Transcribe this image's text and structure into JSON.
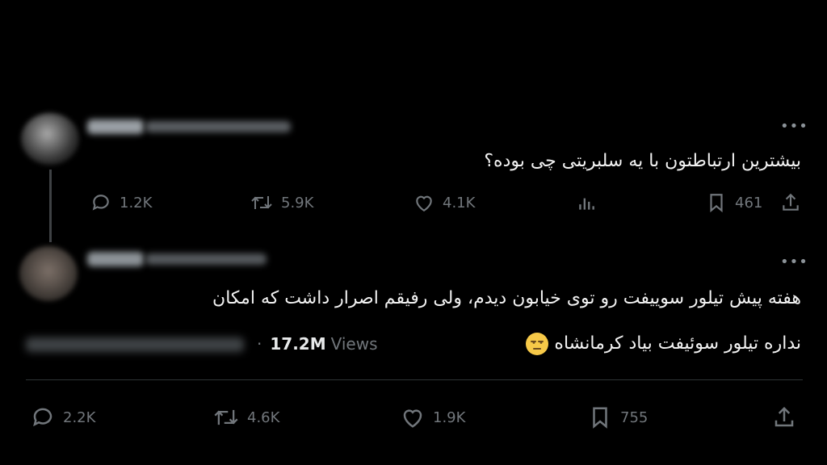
{
  "tweet": {
    "question": "بیشترین ارتباطتون با یه سلبریتی چی بوده؟",
    "actions": {
      "replies": "1.2K",
      "retweets": "5.9K",
      "likes": "4.1K",
      "bookmarks": "461"
    },
    "menu_icon": "more-dots-icon"
  },
  "reply": {
    "line1": "هفته پیش تیلور سوییفت رو توی خیابون دیدم، ولی رفیقم اصرار داشت که امکان",
    "line2": "نداره تیلور سوئیفت بیاد کرمانشاه",
    "emoji": "unamused-face-emoji",
    "views_count": "17.2M",
    "views_label": "Views",
    "actions": {
      "replies": "2.2K",
      "retweets": "4.6K",
      "likes": "1.9K",
      "bookmarks": "755"
    },
    "menu_icon": "more-dots-icon"
  },
  "colors": {
    "background": "#000000",
    "text": "#e7e9ea",
    "muted": "#71767b",
    "divider": "#2f3336"
  }
}
